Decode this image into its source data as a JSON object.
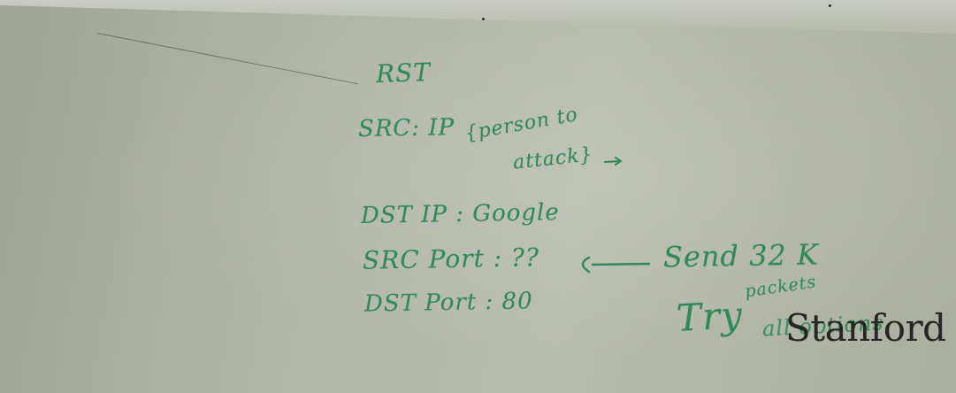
{
  "board": {
    "rst": "RST",
    "src_ip": "SRC: IP",
    "person": "{person to",
    "attack": "attack}",
    "dst_ip": "DST IP  : Google",
    "src_port": "SRC Port : ??",
    "send": "Send 32 K",
    "packets": "packets",
    "try": "Try",
    "options": "all options",
    "dst_port": "DST Port : 80"
  },
  "watermark": "Stanford",
  "colors": {
    "marker": "#2f8a55",
    "board": "#b3b7aa",
    "watermark": "#262626"
  }
}
